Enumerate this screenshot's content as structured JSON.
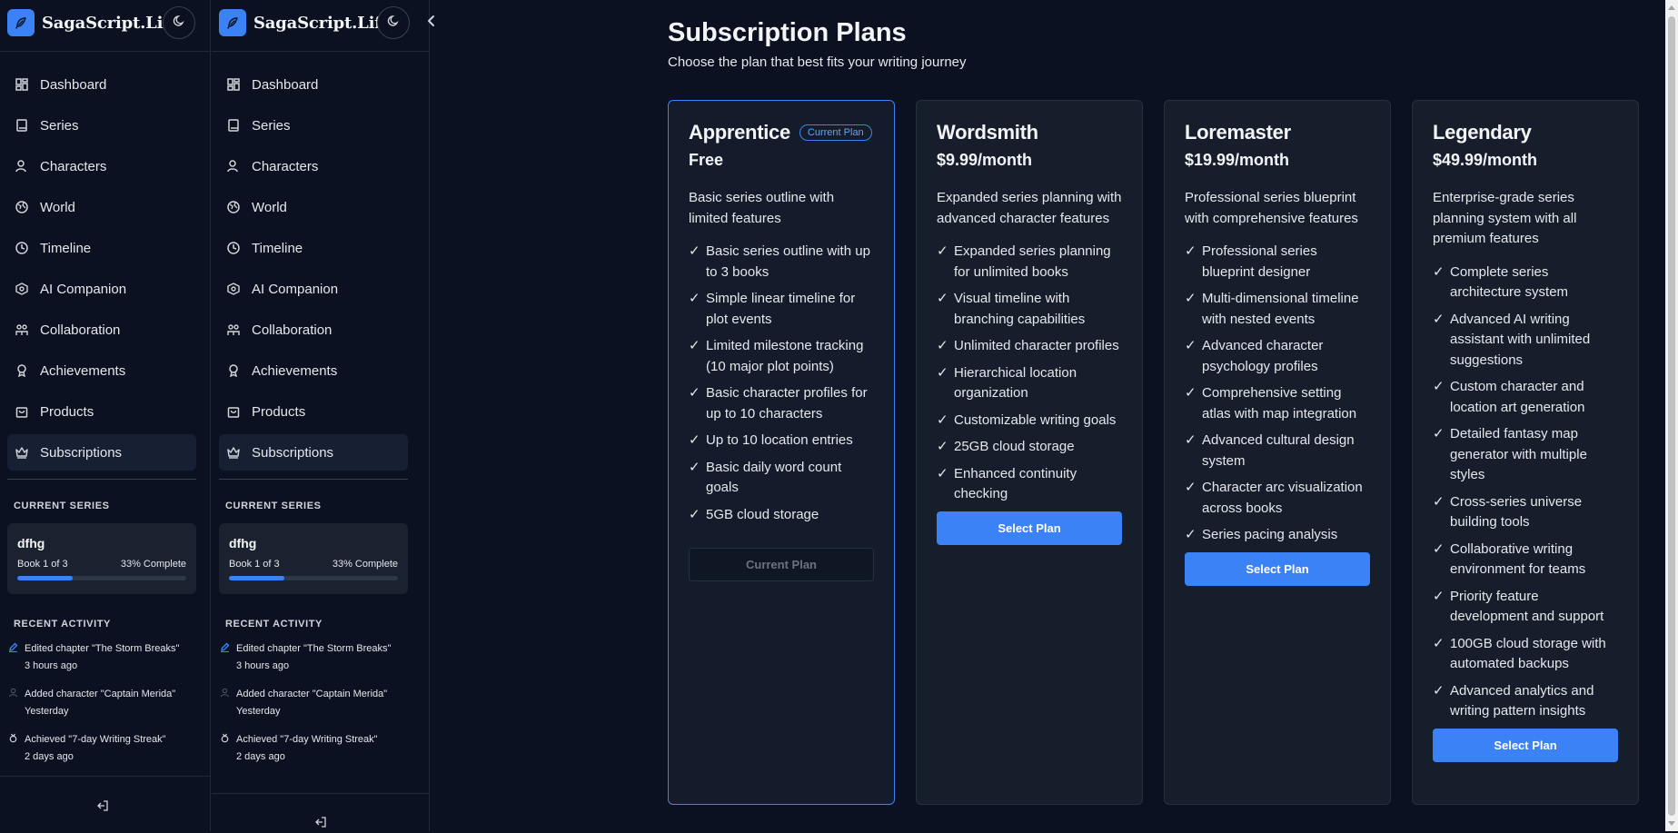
{
  "brand": {
    "name": "SagaScript.Life",
    "accent": "#3b82f6"
  },
  "sidebar": {
    "items": [
      {
        "label": "Dashboard",
        "icon": "dashboard-icon"
      },
      {
        "label": "Series",
        "icon": "book-icon"
      },
      {
        "label": "Characters",
        "icon": "user-icon"
      },
      {
        "label": "World",
        "icon": "globe-icon"
      },
      {
        "label": "Timeline",
        "icon": "clock-icon"
      },
      {
        "label": "AI Companion",
        "icon": "ai-icon"
      },
      {
        "label": "Collaboration",
        "icon": "users-icon"
      },
      {
        "label": "Achievements",
        "icon": "award-icon"
      },
      {
        "label": "Products",
        "icon": "shopping-bag-icon"
      },
      {
        "label": "Subscriptions",
        "icon": "crown-icon",
        "active": true
      }
    ],
    "current_series_title": "CURRENT SERIES",
    "series": {
      "name": "dfhg",
      "book": "Book 1 of 3",
      "complete": "33% Complete",
      "progress": 0.33
    },
    "recent_activity_title": "RECENT ACTIVITY",
    "activity": [
      {
        "text": "Edited chapter \"The Storm Breaks\"",
        "time": "3 hours ago",
        "icon": "pencil-icon"
      },
      {
        "text": "Added character \"Captain Merida\"",
        "time": "Yesterday",
        "icon": "user-icon"
      },
      {
        "text": "Achieved \"7-day Writing Streak\"",
        "time": "2 days ago",
        "icon": "medal-icon"
      }
    ]
  },
  "main": {
    "title": "Subscription Plans",
    "subtitle": "Choose the plan that best fits your writing journey",
    "plans": [
      {
        "name": "Apprentice",
        "price": "Free",
        "badge": "Current Plan",
        "current": true,
        "description": "Basic series outline with limited features",
        "features": [
          "Basic series outline with up to 3 books",
          "Simple linear timeline for plot events",
          "Limited milestone tracking (10 major plot points)",
          "Basic character profiles for up to 10 characters",
          "Up to 10 location entries",
          "Basic daily word count goals",
          "5GB cloud storage"
        ],
        "button": "Current Plan"
      },
      {
        "name": "Wordsmith",
        "price": "$9.99/month",
        "current": false,
        "description": "Expanded series planning with advanced character features",
        "features": [
          "Expanded series planning for unlimited books",
          "Visual timeline with branching capabilities",
          "Unlimited character profiles",
          "Hierarchical location organization",
          "Customizable writing goals",
          "25GB cloud storage",
          "Enhanced continuity checking"
        ],
        "button": "Select Plan"
      },
      {
        "name": "Loremaster",
        "price": "$19.99/month",
        "current": false,
        "description": "Professional series blueprint with comprehensive features",
        "features": [
          "Professional series blueprint designer",
          "Multi-dimensional timeline with nested events",
          "Advanced character psychology profiles",
          "Comprehensive setting atlas with map integration",
          "Advanced cultural design system",
          "Character arc visualization across books",
          "Series pacing analysis"
        ],
        "button": "Select Plan"
      },
      {
        "name": "Legendary",
        "price": "$49.99/month",
        "current": false,
        "description": "Enterprise-grade series planning system with all premium features",
        "features": [
          "Complete series architecture system",
          "Advanced AI writing assistant with unlimited suggestions",
          "Custom character and location art generation",
          "Detailed fantasy map generator with multiple styles",
          "Cross-series universe building tools",
          "Collaborative writing environment for teams",
          "Priority feature development and support",
          "100GB cloud storage with automated backups",
          "Advanced analytics and writing pattern insights"
        ],
        "button": "Select Plan"
      }
    ]
  }
}
